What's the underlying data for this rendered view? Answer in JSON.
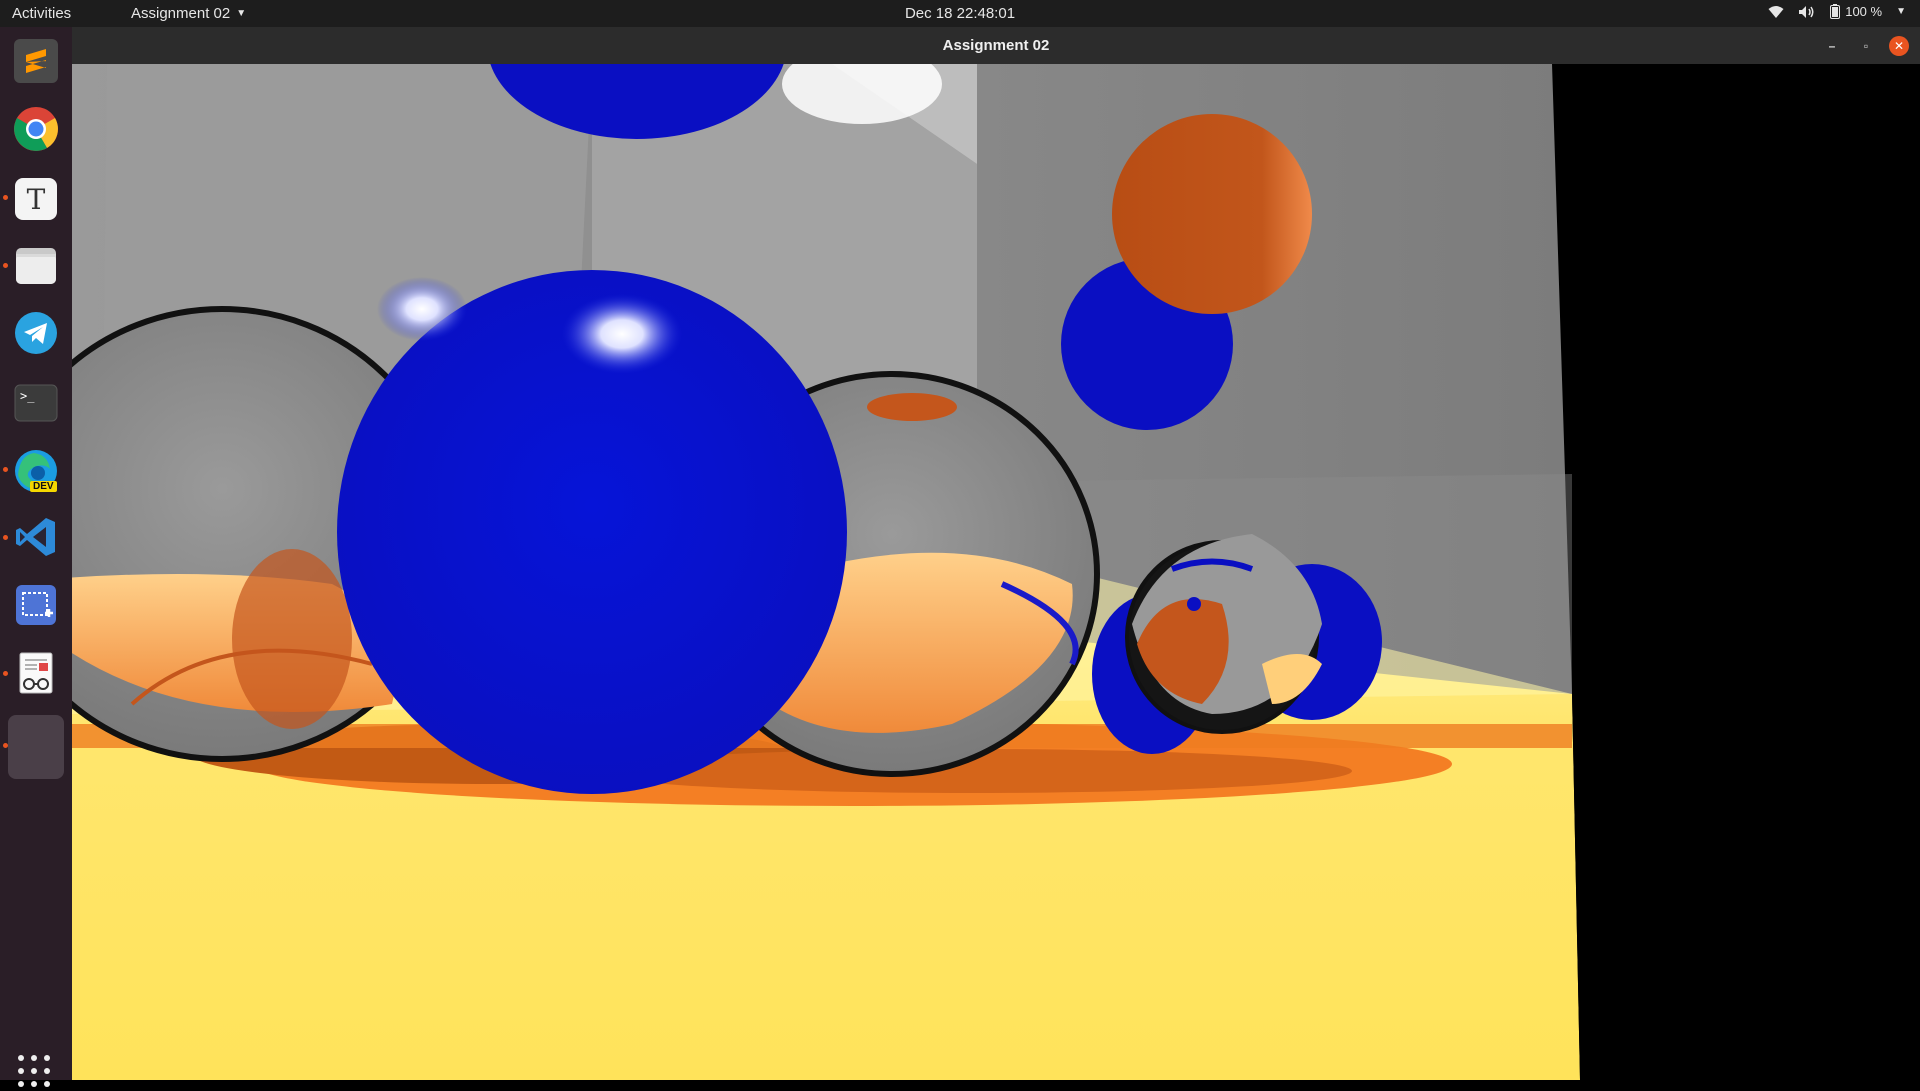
{
  "topbar": {
    "activities": "Activities",
    "app_menu": "Assignment 02",
    "clock": "Dec 18  22:48:01",
    "battery": "100 %"
  },
  "dock": {
    "items": [
      {
        "name": "sublime-text-icon",
        "running": false
      },
      {
        "name": "chrome-icon",
        "running": false
      },
      {
        "name": "text-editor-icon",
        "running": true
      },
      {
        "name": "files-icon",
        "running": true
      },
      {
        "name": "telegram-icon",
        "running": false
      },
      {
        "name": "terminal-icon",
        "running": false
      },
      {
        "name": "edge-dev-icon",
        "running": true
      },
      {
        "name": "vscode-icon",
        "running": true
      },
      {
        "name": "screenshot-icon",
        "running": false
      },
      {
        "name": "document-viewer-icon",
        "running": true
      },
      {
        "name": "active-app-icon",
        "running": true
      }
    ],
    "edge_badge": "DEV",
    "terminal_prompt": ">_",
    "text_editor_letter": "T"
  },
  "window": {
    "title": "Assignment 02",
    "controls": {
      "minimize": "–",
      "maximize": "▫",
      "close": "✕"
    }
  },
  "colors": {
    "accent": "#e95420",
    "dock_bg": "#2a1e27",
    "sphere_blue": "#0a10c8",
    "sphere_orange": "#c4561c",
    "floor_yellow": "#ffe46a",
    "wall_gray": "#8a8a8a"
  }
}
